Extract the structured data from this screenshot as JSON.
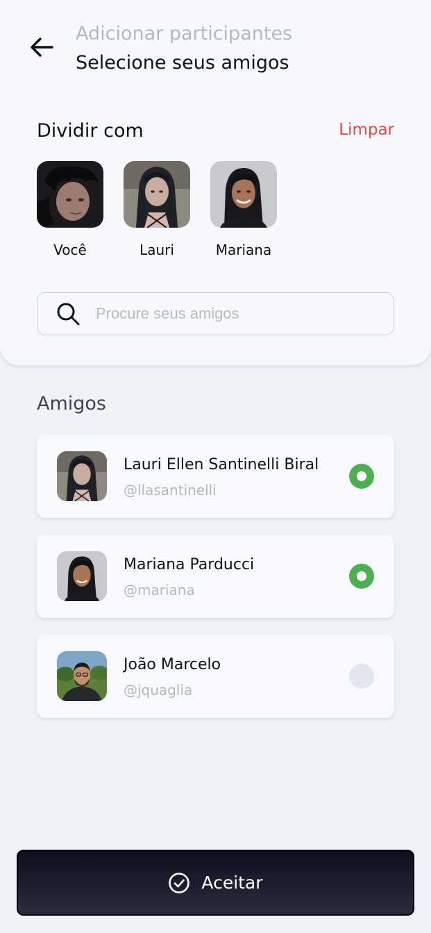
{
  "header": {
    "subtitle": "Adicionar participantes",
    "title": "Selecione seus amigos",
    "back_icon": "arrow-left-icon"
  },
  "split_section": {
    "title": "Dividir com",
    "clear_label": "Limpar",
    "selected": [
      {
        "name": "Você",
        "avatar": "avatar-voce"
      },
      {
        "name": "Lauri",
        "avatar": "avatar-lauri"
      },
      {
        "name": "Mariana",
        "avatar": "avatar-mariana"
      }
    ]
  },
  "search": {
    "placeholder": "Procure seus amigos",
    "value": "",
    "icon": "search-icon"
  },
  "friends": {
    "title": "Amigos",
    "items": [
      {
        "name": "Lauri Ellen Santinelli Biral",
        "handle": "@llasantinelli",
        "selected": true
      },
      {
        "name": "Mariana Parducci",
        "handle": "@mariana",
        "selected": true
      },
      {
        "name": "João Marcelo",
        "handle": "@jquaglia",
        "selected": false
      }
    ]
  },
  "action": {
    "accept_label": "Aceitar",
    "accept_icon": "check-circle-icon"
  },
  "colors": {
    "accent_red": "#e24b4b",
    "selected_green": "#4caf50",
    "unselected_radio": "#e2e7ef",
    "button_dark": "#0e0f1e"
  }
}
